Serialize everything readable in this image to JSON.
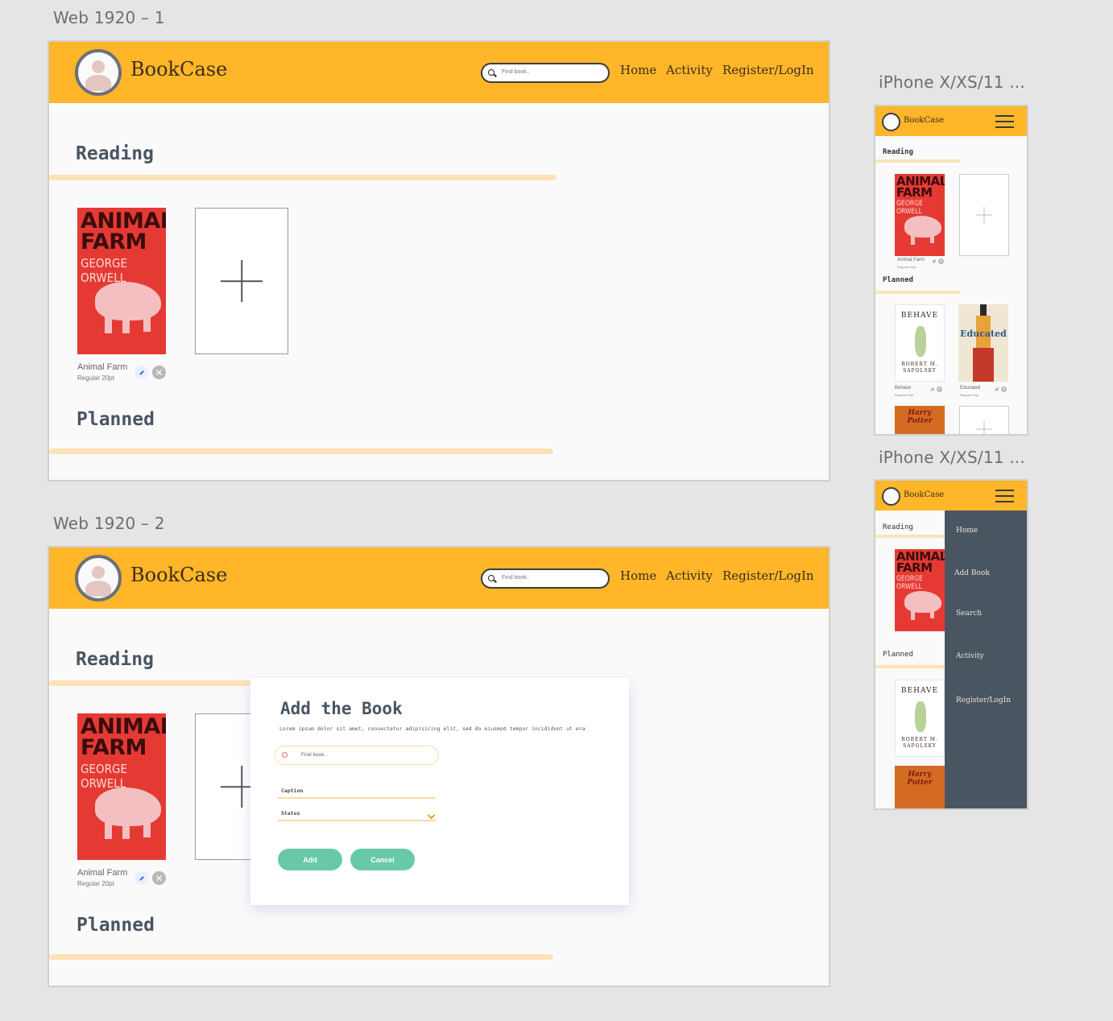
{
  "artboards": {
    "web1": "Web 1920 – 1",
    "web2": "Web 1920 – 2",
    "mob1": "iPhone X/XS/11 ...",
    "mob2": "iPhone X/XS/11 ..."
  },
  "header": {
    "brand": "BookCase",
    "search_placeholder": "Find book..",
    "nav": [
      "Home",
      "Activity",
      "Register/LogIn"
    ]
  },
  "sections": {
    "reading": "Reading",
    "planned": "Planned"
  },
  "book": {
    "cover_title_line1": "ANIMAL",
    "cover_title_line2": "FARM",
    "cover_author": "GEORGE ORWELL",
    "caption": "Animal Farm",
    "subcaption": "Regular 20pt"
  },
  "modal": {
    "title": "Add the Book",
    "description": "Lorem ipsum dolor sit amet, consectetur adipisicing elit, sed do eiusmod tempor incididunt ut era",
    "search_placeholder": "Find book..",
    "caption_label": "Caption",
    "status_label": "Status",
    "add_button": "Add",
    "cancel_button": "Cancel"
  },
  "mobile": {
    "behave_title": "BEHAVE",
    "behave_author_line1": "ROBERT M.",
    "behave_author_line2": "SAPOLSKY",
    "behave_caption": "Behave",
    "educated_title": "Educated",
    "educated_caption": "Educated",
    "harry_title": "Harry Potter",
    "subcaption": "Regular 20pt",
    "menu": [
      "Home",
      "Add Book",
      "Search",
      "Activity",
      "Register/LogIn"
    ]
  },
  "colors": {
    "header": "#ffb629",
    "accent_rule": "#fde2b6",
    "button": "#67c9a9",
    "menu_bg": "#4a5562"
  }
}
